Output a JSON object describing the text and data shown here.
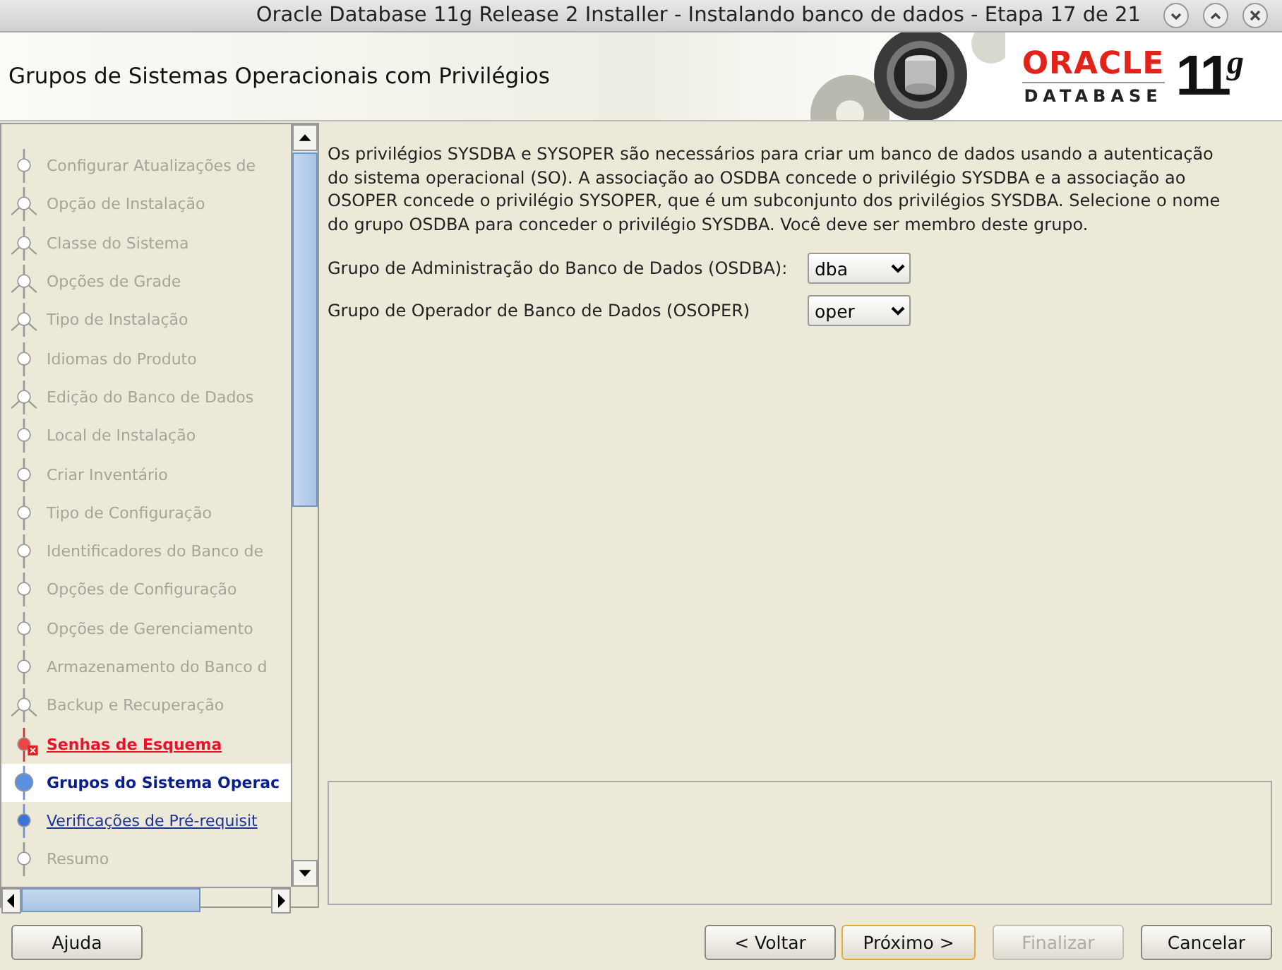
{
  "window": {
    "title": "Oracle Database 11g Release 2 Installer - Instalando banco de dados - Etapa 17 de 21"
  },
  "header": {
    "title": "Grupos de Sistemas Operacionais com Privilégios",
    "logo_brand": "ORACLE",
    "logo_product": "DATABASE",
    "logo_version": "11",
    "logo_suffix": "g"
  },
  "steps": [
    {
      "label": "Configurar Atualizações de",
      "kind": "plain",
      "selected": false
    },
    {
      "label": "Opção de Instalação",
      "kind": "branch",
      "selected": false
    },
    {
      "label": "Classe do Sistema",
      "kind": "branch",
      "selected": false
    },
    {
      "label": "Opções de Grade",
      "kind": "branch",
      "selected": false
    },
    {
      "label": "Tipo de Instalação",
      "kind": "branch",
      "selected": false
    },
    {
      "label": "Idiomas do Produto",
      "kind": "plain",
      "selected": false
    },
    {
      "label": "Edição do Banco de Dados",
      "kind": "branch",
      "selected": false
    },
    {
      "label": "Local de Instalação",
      "kind": "plain",
      "selected": false
    },
    {
      "label": "Criar Inventário",
      "kind": "plain",
      "selected": false
    },
    {
      "label": "Tipo de Configuração",
      "kind": "plain",
      "selected": false
    },
    {
      "label": "Identificadores do Banco de",
      "kind": "plain",
      "selected": false
    },
    {
      "label": "Opções de Configuração",
      "kind": "plain",
      "selected": false
    },
    {
      "label": "Opções de Gerenciamento",
      "kind": "plain",
      "selected": false
    },
    {
      "label": "Armazenamento do Banco d",
      "kind": "plain",
      "selected": false
    },
    {
      "label": "Backup e Recuperação",
      "kind": "branch",
      "selected": false
    },
    {
      "label": "Senhas de Esquema",
      "kind": "error",
      "selected": false
    },
    {
      "label": "Grupos do Sistema Operac",
      "kind": "link",
      "selected": true
    },
    {
      "label": "Verificações de Pré-requisit",
      "kind": "link",
      "selected": false
    },
    {
      "label": "Resumo",
      "kind": "plain",
      "selected": false
    }
  ],
  "content": {
    "description": "Os privilégios SYSDBA e SYSOPER são necessários para criar um banco de dados usando a autenticação do sistema operacional (SO). A associação ao OSDBA concede o privilégio SYSDBA e a associação ao OSOPER concede o privilégio SYSOPER, que é um subconjunto dos privilégios SYSDBA. Selecione o nome do grupo OSDBA para conceder o privilégio SYSDBA. Você deve ser membro deste grupo.",
    "fields": [
      {
        "label": "Grupo de Administração do Banco de Dados (OSDBA):",
        "value": "dba"
      },
      {
        "label": "Grupo de Operador de Banco de Dados (OSOPER)",
        "value": "oper"
      }
    ]
  },
  "buttons": {
    "help": "Ajuda",
    "back": "< Voltar",
    "next": "Próximo >",
    "finish": "Finalizar",
    "cancel": "Cancelar"
  },
  "finish_disabled": true
}
